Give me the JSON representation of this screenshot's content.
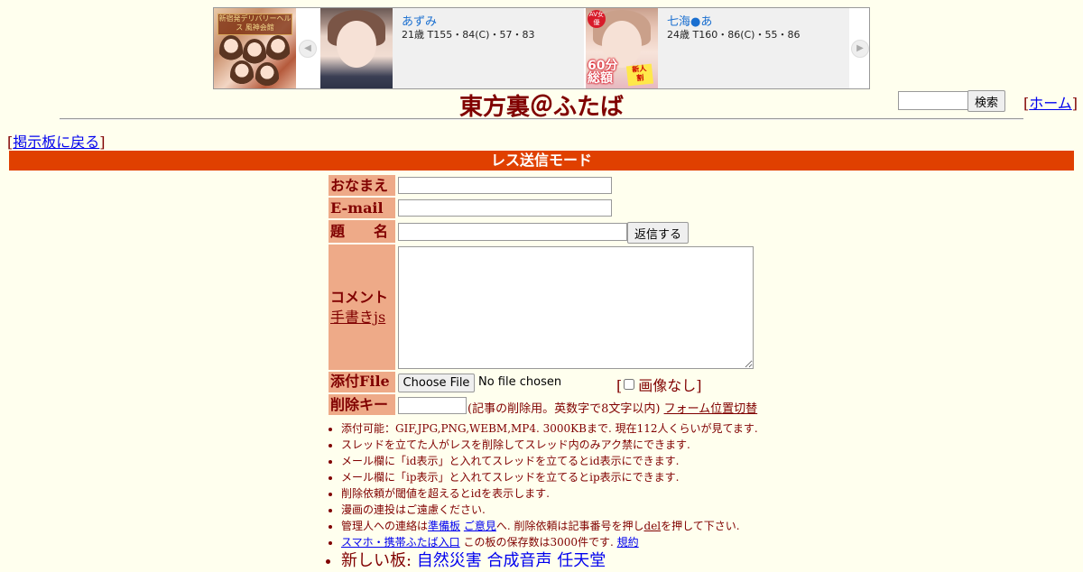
{
  "banner": {
    "logo_text": "新宿発デリバリーヘルス 風神会館",
    "cards": [
      {
        "name": "あずみ",
        "stats": "21歳 T155・84(C)・57・83"
      },
      {
        "name": "七海●あ",
        "stats": "24歳 T160・86(C)・55・86",
        "badge": "AV女優",
        "promo": "60分\n総額",
        "promo2": "新人\n割"
      }
    ],
    "prev_icon": "chevron-left-icon",
    "next_icon": "chevron-right-icon"
  },
  "header": {
    "title": "東方裏＠ふたば",
    "search_button": "検索",
    "home_link": "ホーム",
    "back_link": "掲示板に戻る"
  },
  "mode_bar": "レス送信モード",
  "form": {
    "name_label": "おなまえ",
    "email_label": "E-mail",
    "subject_label": "題　　名",
    "submit_label": "返信する",
    "comment_label": "コメント",
    "handwrite_link": "手書きjs",
    "file_label": "添付File",
    "file_button": "Choose File",
    "file_status": "No file chosen",
    "no_image_label": "画像なし",
    "delkey_label": "削除キー",
    "delkey_note": "(記事の削除用。英数字で8文字以内)",
    "form_toggle": "フォーム位置切替"
  },
  "rules": {
    "r1": "添付可能：GIF,JPG,PNG,WEBM,MP4. 3000KBまで. 現在112人くらいが見てます.",
    "r2": "スレッドを立てた人がレスを削除してスレッド内のみアク禁にできます.",
    "r3": "メール欄に「id表示」と入れてスレッドを立てるとid表示にできます.",
    "r4": "メール欄に「ip表示」と入れてスレッドを立てるとip表示にできます.",
    "r5": "削除依頼が閾値を超えるとidを表示します.",
    "r6": "漫画の連投はご遠慮ください.",
    "r7_a": "管理人への連絡は",
    "r7_link1": "準備板",
    "r7_link2": "ご意見",
    "r7_b": "へ. 削除依頼は記事番号を押し",
    "r7_del": "del",
    "r7_c": "を押して下さい.",
    "r8_link": "スマホ・携帯ふたば入口",
    "r8_text": " この板の保存数は3000件です.",
    "r8_terms": "規約",
    "r9_prefix": "新しい板: ",
    "r9_links": [
      "自然災害",
      "合成音声",
      "任天堂"
    ]
  }
}
